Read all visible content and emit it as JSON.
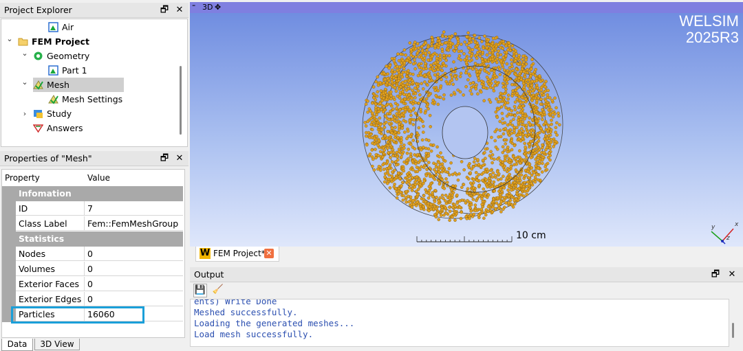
{
  "project_explorer": {
    "title": "Project Explorer",
    "items": [
      {
        "label": "Air",
        "icon": "part-icon",
        "depth": 2,
        "chevron": ""
      },
      {
        "label": "FEM Project",
        "icon": "folder-icon",
        "depth": 0,
        "chevron": "expanded",
        "bold": true
      },
      {
        "label": "Geometry",
        "icon": "geometry-icon",
        "depth": 1,
        "chevron": "expanded"
      },
      {
        "label": "Part 1",
        "icon": "part-icon",
        "depth": 2,
        "chevron": ""
      },
      {
        "label": "Mesh",
        "icon": "mesh-icon",
        "depth": 1,
        "chevron": "expanded",
        "selected": true
      },
      {
        "label": "Mesh Settings",
        "icon": "mesh-settings-icon",
        "depth": 2,
        "chevron": ""
      },
      {
        "label": "Study",
        "icon": "study-icon",
        "depth": 1,
        "chevron": "collapsed"
      },
      {
        "label": "Answers",
        "icon": "answers-icon",
        "depth": 1,
        "chevron": ""
      }
    ]
  },
  "properties": {
    "title": "Properties of \"Mesh\"",
    "header": {
      "property": "Property",
      "value": "Value"
    },
    "groups": [
      {
        "name": "Infomation",
        "rows": [
          {
            "name": "ID",
            "value": "7"
          },
          {
            "name": "Class Label",
            "value": "Fem::FemMeshGroup"
          }
        ]
      },
      {
        "name": "Statistics",
        "rows": [
          {
            "name": "Nodes",
            "value": "0"
          },
          {
            "name": "Volumes",
            "value": "0"
          },
          {
            "name": "Exterior Faces",
            "value": "0"
          },
          {
            "name": "Exterior Edges",
            "value": "0"
          },
          {
            "name": "Particles",
            "value": "16060",
            "highlighted": true
          }
        ]
      }
    ]
  },
  "bottom_tabs": {
    "data": "Data",
    "view3d": "3D View"
  },
  "viewport": {
    "toolbar_label": "3D",
    "watermark_line1": "WELSIM",
    "watermark_line2": "2025R3",
    "scale_label": "10 cm",
    "axis_labels": {
      "x": "x",
      "y": "y",
      "z": "z"
    },
    "particle_color": "#e0a020"
  },
  "doc_tab": {
    "icon_letter": "W",
    "label": "FEM Project*"
  },
  "output": {
    "title": "Output",
    "log": [
      "ents) Write Done",
      "Meshed successfully.",
      "Loading the generated meshes...",
      "Load mesh successfully."
    ]
  },
  "colors": {
    "highlight_box": "#1a9fd9",
    "selection": "#cfcfcf",
    "link_blue": "#2b4fb0"
  }
}
